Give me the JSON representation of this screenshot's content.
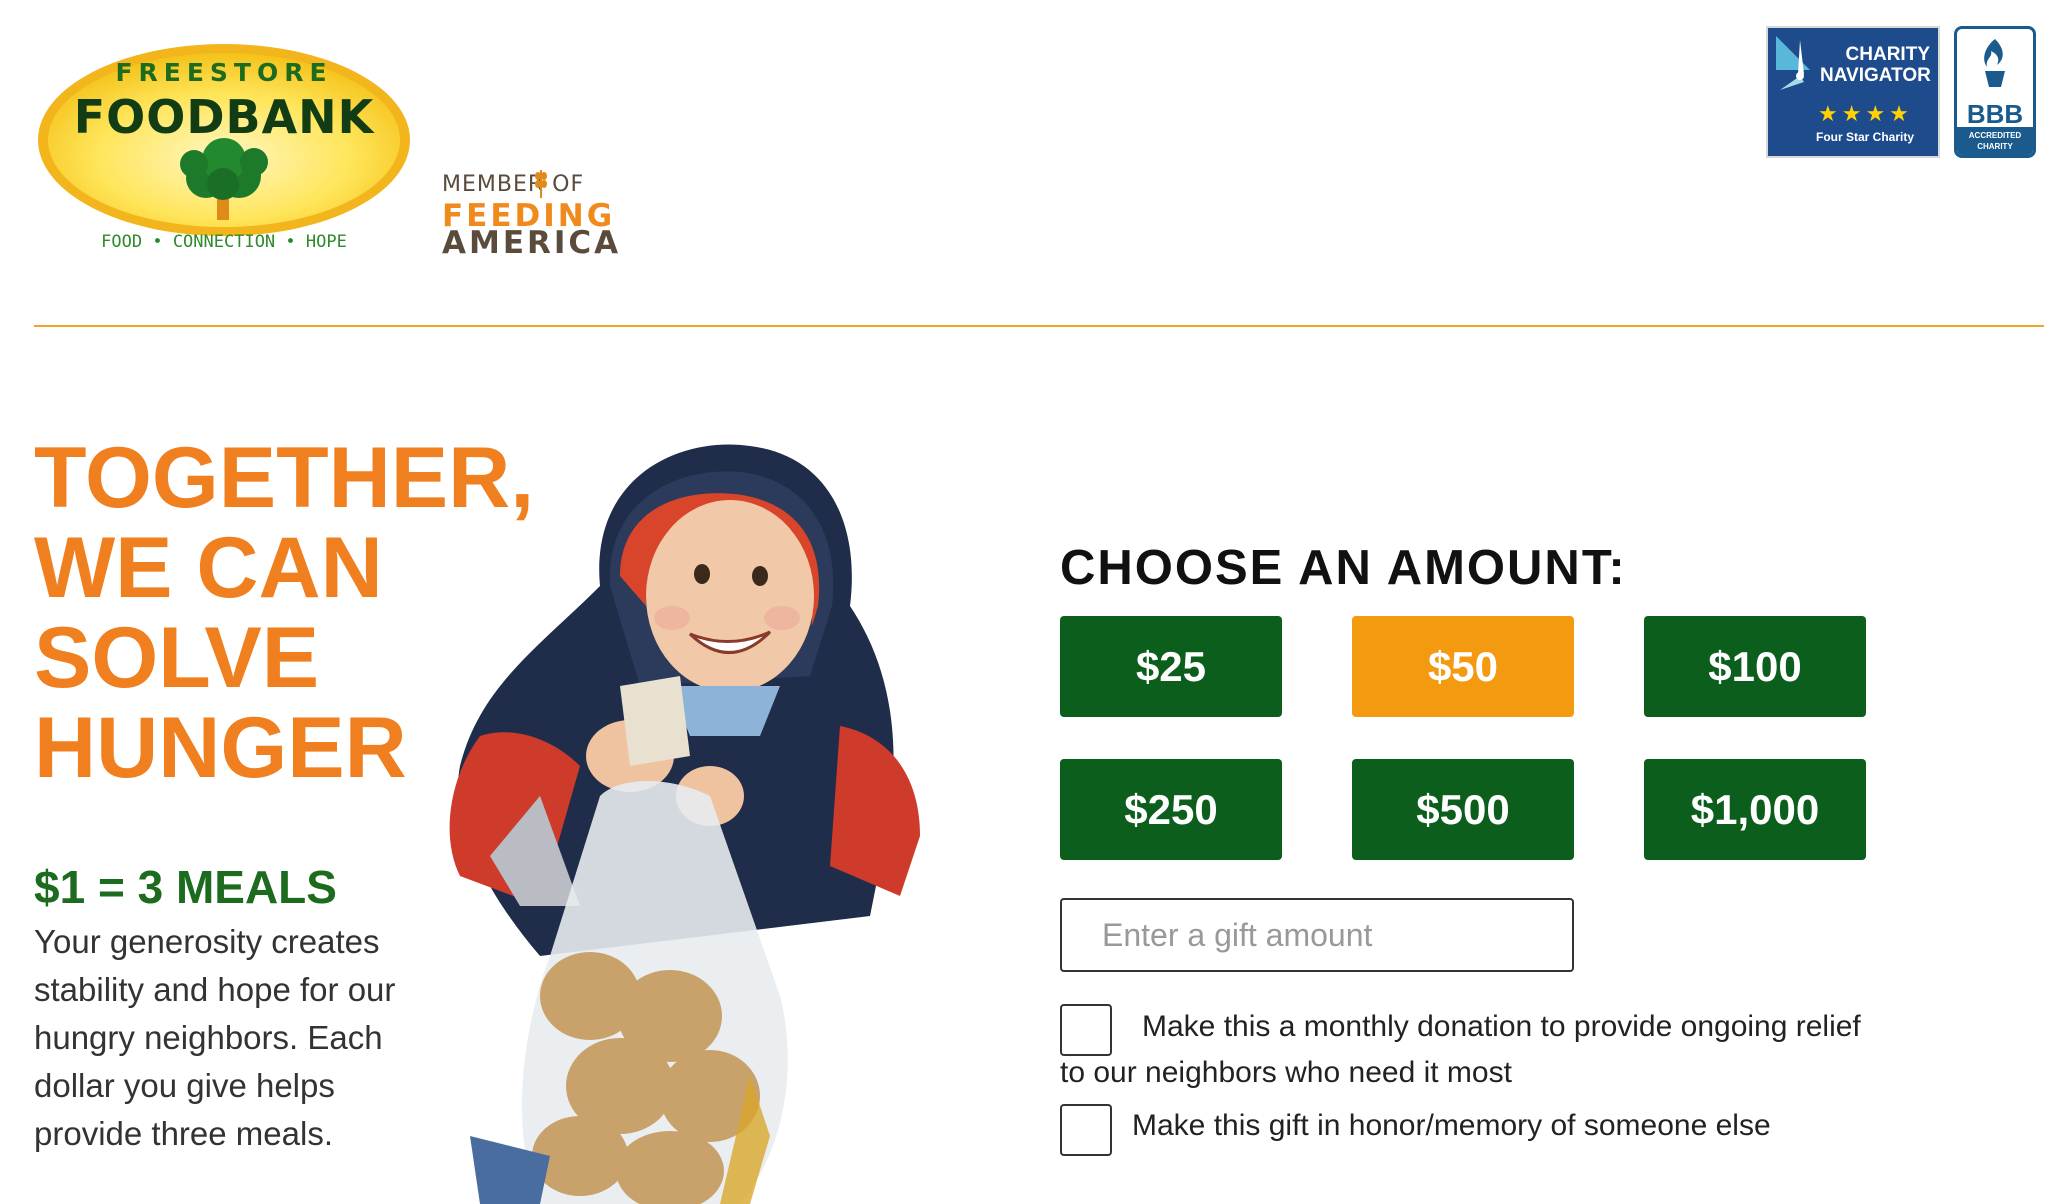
{
  "header": {
    "logo": {
      "line1": "FREESTORE",
      "line2": "FOODBANK",
      "tagline": "FOOD • CONNECTION • HOPE"
    },
    "feeding_america": {
      "member_of": "MEMBER OF",
      "feeding": "FEEDING",
      "america": "AMERICA"
    },
    "charity_navigator": {
      "name": "CHARITY NAVIGATOR",
      "stars": "★★★★",
      "tagline": "Four Star Charity"
    },
    "bbb": {
      "text": "BBB",
      "tagline": "ACCREDITED CHARITY"
    }
  },
  "hero": {
    "headline_lines": [
      "TOGETHER,",
      "WE CAN",
      "SOLVE",
      "HUNGER"
    ],
    "meals": "$1 = 3 MEALS",
    "blurb": "Your generosity creates stability and hope for our hungry neighbors. Each dollar you give helps provide three meals."
  },
  "donation": {
    "title": "CHOOSE AN AMOUNT:",
    "amounts": [
      "$25",
      "$50",
      "$100",
      "$250",
      "$500",
      "$1,000"
    ],
    "selected_amount": "$50",
    "gift_placeholder": "Enter a gift amount",
    "monthly_label": "Make this a monthly donation to provide ongoing relief to our neighbors who need it most",
    "honor_label": "Make this gift in honor/memory of someone else"
  },
  "colors": {
    "brand_green": "#0b5e1c",
    "brand_orange": "#f07f1f",
    "selected_orange": "#f39a11",
    "divider": "#f0a42c"
  }
}
